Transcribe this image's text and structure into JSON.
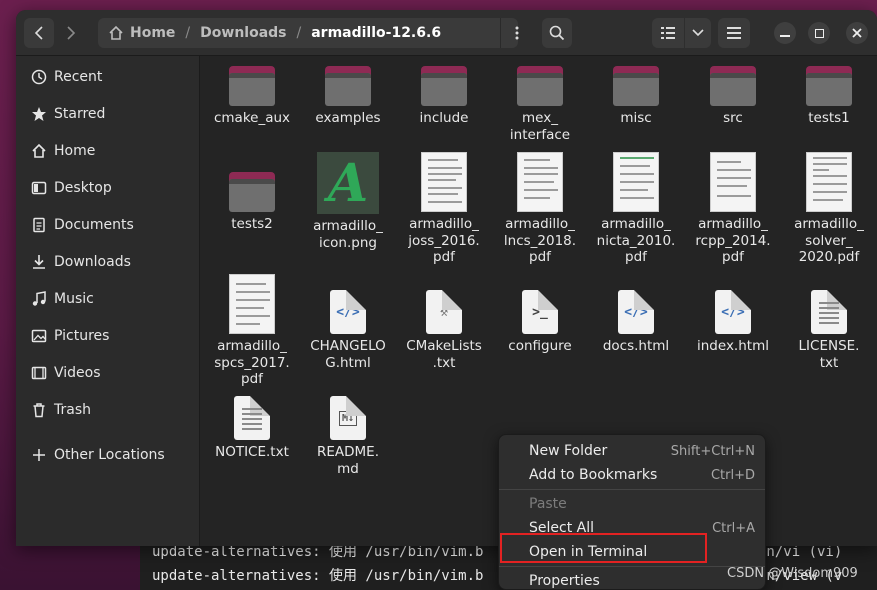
{
  "terminal": {
    "lines": [
      "update-alternatives: 使用 /usr/bin/vim.b",
      "update-alternatives: 使用 /usr/bin/vim.b"
    ],
    "right_fragments": [
      "in/vi (vi)",
      "in/view (v"
    ]
  },
  "header": {
    "path": [
      "Home",
      "Downloads",
      "armadillo-12.6.6"
    ]
  },
  "sidebar": {
    "items": [
      {
        "label": "Recent",
        "icon": "clock-icon"
      },
      {
        "label": "Starred",
        "icon": "star-icon"
      },
      {
        "label": "Home",
        "icon": "home-icon"
      },
      {
        "label": "Desktop",
        "icon": "desktop-icon"
      },
      {
        "label": "Documents",
        "icon": "documents-icon"
      },
      {
        "label": "Downloads",
        "icon": "download-icon"
      },
      {
        "label": "Music",
        "icon": "music-icon"
      },
      {
        "label": "Pictures",
        "icon": "pictures-icon"
      },
      {
        "label": "Videos",
        "icon": "videos-icon"
      },
      {
        "label": "Trash",
        "icon": "trash-icon"
      }
    ],
    "other_locations": "Other Locations"
  },
  "files": [
    {
      "name": "cmake_aux",
      "kind": "folder"
    },
    {
      "name": "examples",
      "kind": "folder"
    },
    {
      "name": "include",
      "kind": "folder"
    },
    {
      "name": "mex_\ninterface",
      "kind": "folder"
    },
    {
      "name": "misc",
      "kind": "folder"
    },
    {
      "name": "src",
      "kind": "folder"
    },
    {
      "name": "tests1",
      "kind": "folder"
    },
    {
      "name": "tests2",
      "kind": "folder"
    },
    {
      "name": "armadillo_\nicon.png",
      "kind": "png"
    },
    {
      "name": "armadillo_\njoss_2016.\npdf",
      "kind": "pdf"
    },
    {
      "name": "armadillo_\nlncs_2018.\npdf",
      "kind": "pdf"
    },
    {
      "name": "armadillo_\nnicta_2010.\npdf",
      "kind": "pdf"
    },
    {
      "name": "armadillo_\nrcpp_2014.\npdf",
      "kind": "pdf"
    },
    {
      "name": "armadillo_\nsolver_\n2020.pdf",
      "kind": "pdf"
    },
    {
      "name": "armadillo_\nspcs_2017.\npdf",
      "kind": "pdf"
    },
    {
      "name": "CHANGELO\nG.html",
      "kind": "html"
    },
    {
      "name": "CMakeLists\n.txt",
      "kind": "cmake"
    },
    {
      "name": "configure",
      "kind": "script"
    },
    {
      "name": "docs.html",
      "kind": "html"
    },
    {
      "name": "index.html",
      "kind": "html"
    },
    {
      "name": "LICENSE.\ntxt",
      "kind": "txt"
    },
    {
      "name": "NOTICE.txt",
      "kind": "txt"
    },
    {
      "name": "README.\nmd",
      "kind": "md"
    }
  ],
  "context_menu": {
    "items": [
      {
        "label": "New Folder",
        "shortcut": "Shift+Ctrl+N",
        "disabled": false
      },
      {
        "label": "Add to Bookmarks",
        "shortcut": "Ctrl+D",
        "disabled": false
      },
      {
        "label": "Paste",
        "shortcut": "",
        "disabled": true
      },
      {
        "label": "Select All",
        "shortcut": "Ctrl+A",
        "disabled": false
      },
      {
        "label": "Open in Terminal",
        "shortcut": "",
        "disabled": false
      },
      {
        "label": "Properties",
        "shortcut": "",
        "disabled": false
      }
    ]
  },
  "watermark": "CSDN @Wisdom909",
  "colors": {
    "folder_tab": "#8e2a54",
    "highlight_box": "#e32222",
    "desktop_bg": "#6b1f4e"
  }
}
